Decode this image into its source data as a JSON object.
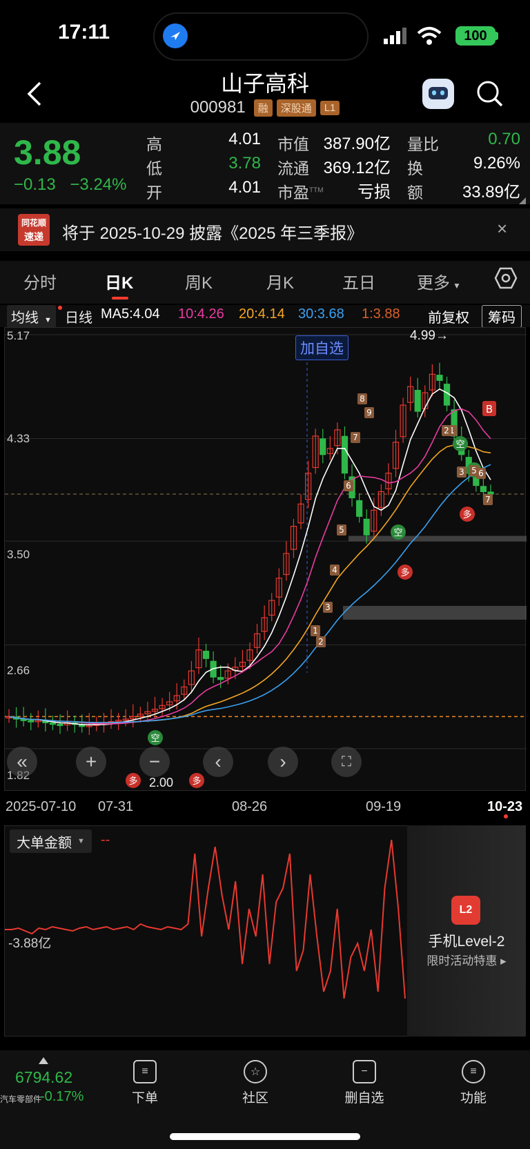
{
  "status_bar": {
    "time": "17:11",
    "battery": "100"
  },
  "header": {
    "stock_name": "山子高科",
    "stock_code": "000981",
    "tags": [
      "融",
      "深股通",
      "L1"
    ]
  },
  "quote": {
    "price": "3.88",
    "change": "−0.13",
    "change_pct": "−3.24%",
    "fields": {
      "high_label": "高",
      "high": "4.01",
      "low_label": "低",
      "low": "3.78",
      "open_label": "开",
      "open": "4.01",
      "mktcap_label": "市值",
      "mktcap": "387.90亿",
      "float_label": "流通",
      "float": "369.12亿",
      "pe_label": "市盈",
      "pe_sup": "TTM",
      "pe": "亏损",
      "vol_ratio_label": "量比",
      "vol_ratio": "0.70",
      "turnover_label": "换",
      "turnover": "9.26%",
      "amount_label": "额",
      "amount": "33.89亿"
    },
    "colors": {
      "down": "#2fb84a",
      "up": "#e8392f"
    }
  },
  "notice": {
    "logo_line1": "同花顺",
    "logo_line2": "速递",
    "text": "将于 2025-10-29 披露《2025 年三季报》",
    "close": "×"
  },
  "tabs": [
    {
      "label": "分时"
    },
    {
      "label": "日K",
      "active": true
    },
    {
      "label": "周K"
    },
    {
      "label": "月K"
    },
    {
      "label": "五日"
    },
    {
      "label": "更多"
    }
  ],
  "ma_row": {
    "indicator": "均线",
    "period": "日线",
    "ma5": "MA5:4.04",
    "ma10": "10:4.26",
    "ma20": "20:4.14",
    "ma30": "30:3.68",
    "ma1": "1:3.88",
    "adjust": "前复权",
    "chips": "筹码",
    "ma_colors": {
      "ma5": "#ffffff",
      "ma10": "#e83ca0",
      "ma20": "#f4a623",
      "ma30": "#3aa0f0",
      "ma1": "#d9602a"
    }
  },
  "chart": {
    "y_ticks": [
      "5.17",
      "4.33",
      "3.50",
      "2.66",
      "1.82"
    ],
    "x_ticks": [
      "2025-07-10",
      "07-31",
      "08-26",
      "09-19",
      "10-23"
    ],
    "max_label": "4.99→",
    "min_label": "2.00",
    "add_watch_label": "加自选"
  },
  "chart_data": {
    "type": "candlestick",
    "ylim": [
      1.82,
      5.17
    ],
    "current_price": 3.88,
    "high_marker": 4.99,
    "low_marker": 2.0,
    "x_ticks": [
      "2025-07-10",
      "07-31",
      "08-26",
      "09-19",
      "10-23"
    ],
    "y_ticks": [
      5.17,
      4.33,
      3.5,
      2.66,
      1.82
    ],
    "close_series": [
      2.08,
      2.06,
      2.05,
      2.04,
      2.05,
      2.03,
      2.02,
      2.01,
      2.03,
      2.02,
      2.0,
      2.01,
      2.02,
      2.03,
      2.04,
      2.05,
      2.06,
      2.08,
      2.1,
      2.12,
      2.14,
      2.17,
      2.2,
      2.25,
      2.32,
      2.45,
      2.62,
      2.55,
      2.4,
      2.38,
      2.45,
      2.48,
      2.52,
      2.62,
      2.75,
      2.88,
      3.02,
      3.2,
      3.4,
      3.62,
      3.8,
      4.05,
      4.35,
      4.2,
      4.25,
      4.4,
      4.05,
      3.85,
      3.7,
      3.55,
      3.75,
      3.9,
      4.05,
      4.3,
      4.6,
      4.75,
      4.55,
      4.7,
      4.85,
      4.8,
      4.6,
      4.35,
      4.2,
      4.05,
      3.95,
      3.9,
      3.88
    ],
    "ma_labels": {
      "MA5": 4.04,
      "MA10": 4.26,
      "MA20": 4.14,
      "MA30": 3.68,
      "MA1": 3.88
    }
  },
  "indicator": {
    "name": "大单金额",
    "value": "--",
    "level_label": "-3.88亿"
  },
  "promo": {
    "icon": "L2",
    "title": "手机Level-2",
    "subtitle": "限时活动特惠"
  },
  "bottom_bar": {
    "index_value": "6794.62",
    "index_name": "汽车零部件",
    "index_change": "-0.17%",
    "items": [
      {
        "label": "下单"
      },
      {
        "label": "社区"
      },
      {
        "label": "删自选"
      },
      {
        "label": "功能"
      }
    ]
  }
}
